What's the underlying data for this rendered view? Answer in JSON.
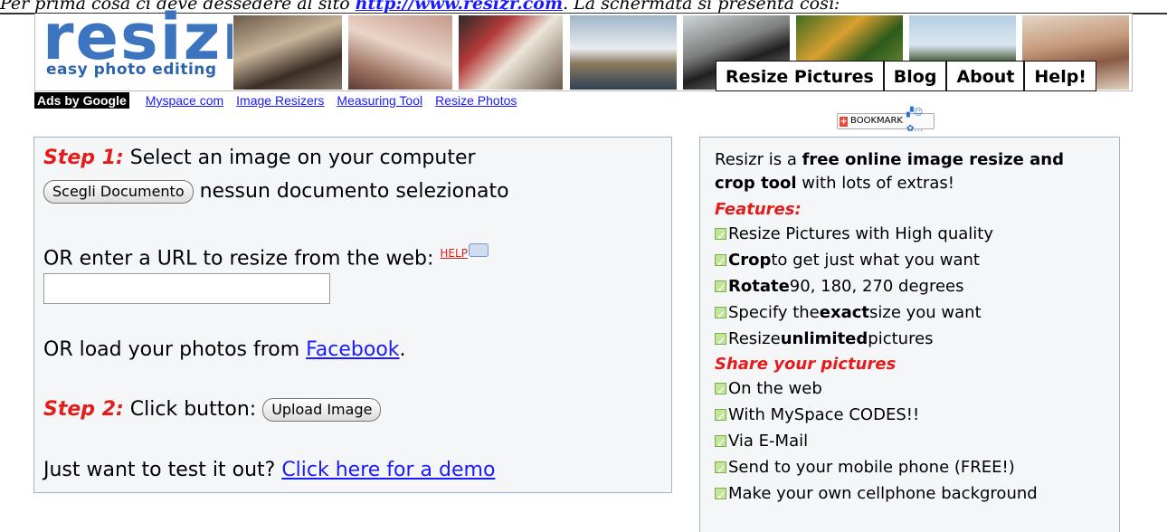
{
  "caption": {
    "text": "Per prima cosa ci deve dessedere al sito ",
    "link": "http://www.resizr.com",
    "rest": ". La schermata si presenta così:"
  },
  "logo": {
    "word": "resizr",
    "tagline": "easy photo editing"
  },
  "nav": [
    "Resize Pictures",
    "Blog",
    "About",
    "Help!"
  ],
  "ads": {
    "badge": "Ads by Google",
    "links": [
      "Myspace com",
      "Image Resizers",
      "Measuring Tool",
      "Resize Photos"
    ]
  },
  "bookmark": {
    "label": "BOOKMARK"
  },
  "left": {
    "step1_label": "Step 1:",
    "step1_text": " Select an image on your computer",
    "choose_button": "Scegli Documento",
    "no_file": " nessun documento selezionato",
    "url_text": "OR enter a URL to resize from the web: ",
    "help": "HELP",
    "facebook_pre": "OR load your photos from ",
    "facebook_link": "Facebook",
    "facebook_post": ".",
    "step2_label": "Step 2:",
    "step2_text": " Click button: ",
    "upload_button": "Upload Image",
    "demo_pre": "Just want to test it out? ",
    "demo_link": "Click here for a demo"
  },
  "right": {
    "intro_pre": "Resizr is a ",
    "intro_bold": "free online image resize and crop tool",
    "intro_post": " with lots of extras!",
    "features_title": "Features:",
    "features": [
      {
        "pre": "",
        "bold": "",
        "post": "Resize Pictures with High quality"
      },
      {
        "pre": "",
        "bold": "Crop",
        "post": " to get just what you want"
      },
      {
        "pre": "",
        "bold": "Rotate",
        "post": " 90, 180, 270 degrees"
      },
      {
        "pre": "Specify the ",
        "bold": "exact",
        "post": " size you want"
      },
      {
        "pre": "Resize ",
        "bold": "unlimited",
        "post": " pictures"
      }
    ],
    "share_title": "Share your pictures",
    "share": [
      "On the web",
      "With MySpace CODES!!",
      "Via E-Mail",
      "Send to your mobile phone (FREE!)",
      "Make your own cellphone background"
    ]
  }
}
